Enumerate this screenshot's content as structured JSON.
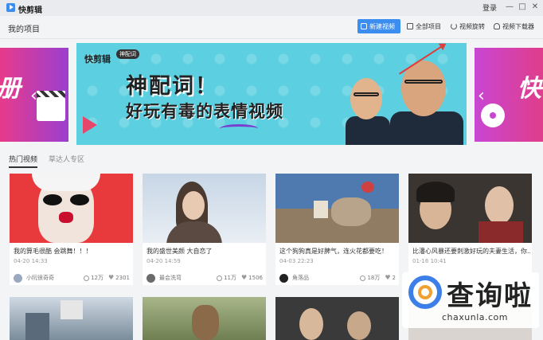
{
  "app": {
    "name": "快剪辑",
    "login": "登录"
  },
  "window_controls": {
    "minimize": "—",
    "maximize": "□",
    "close": "✕"
  },
  "toolbar": {
    "title": "我的项目",
    "new_video": "新建视频",
    "all_projects": "全部项目",
    "video_rotate": "视频旋转",
    "video_downloader": "视频下载器"
  },
  "banner": {
    "brand": "快剪辑",
    "tag": "神配词",
    "headline": "神配词！",
    "subheadline": "好玩有毒的表情视频",
    "left_partial": "册",
    "right_partial": "快"
  },
  "tabs": [
    {
      "label": "热门视频",
      "active": true
    },
    {
      "label": "草达人专区",
      "active": false
    }
  ],
  "videos": [
    {
      "title": "我的算毛很酷 会跳舞！！！",
      "time": "04-20 14:33",
      "author": "小阮很奇奇",
      "plays": "12万",
      "likes": "2301"
    },
    {
      "title": "我的盛世美颜 大自恋了",
      "time": "04-20 14:59",
      "author": "最会洗弯",
      "plays": "11万",
      "likes": "1506"
    },
    {
      "title": "这个狗狗真是好脾气，连火花都要吃！",
      "time": "04-03 22:23",
      "author": "角落品",
      "plays": "18万",
      "likes": "2"
    },
    {
      "title": "比潘心风暴还要刺激好玩的夫妻生活，你...",
      "time": "01-16 10:41",
      "author": "",
      "plays": "",
      "likes": ""
    }
  ],
  "watermark": {
    "text": "查询啦",
    "domain": "chaxunla.com"
  },
  "colors": {
    "accent": "#3b8df0",
    "banner_bg": "#5ccfe0",
    "arrow": "#e23b3b"
  }
}
